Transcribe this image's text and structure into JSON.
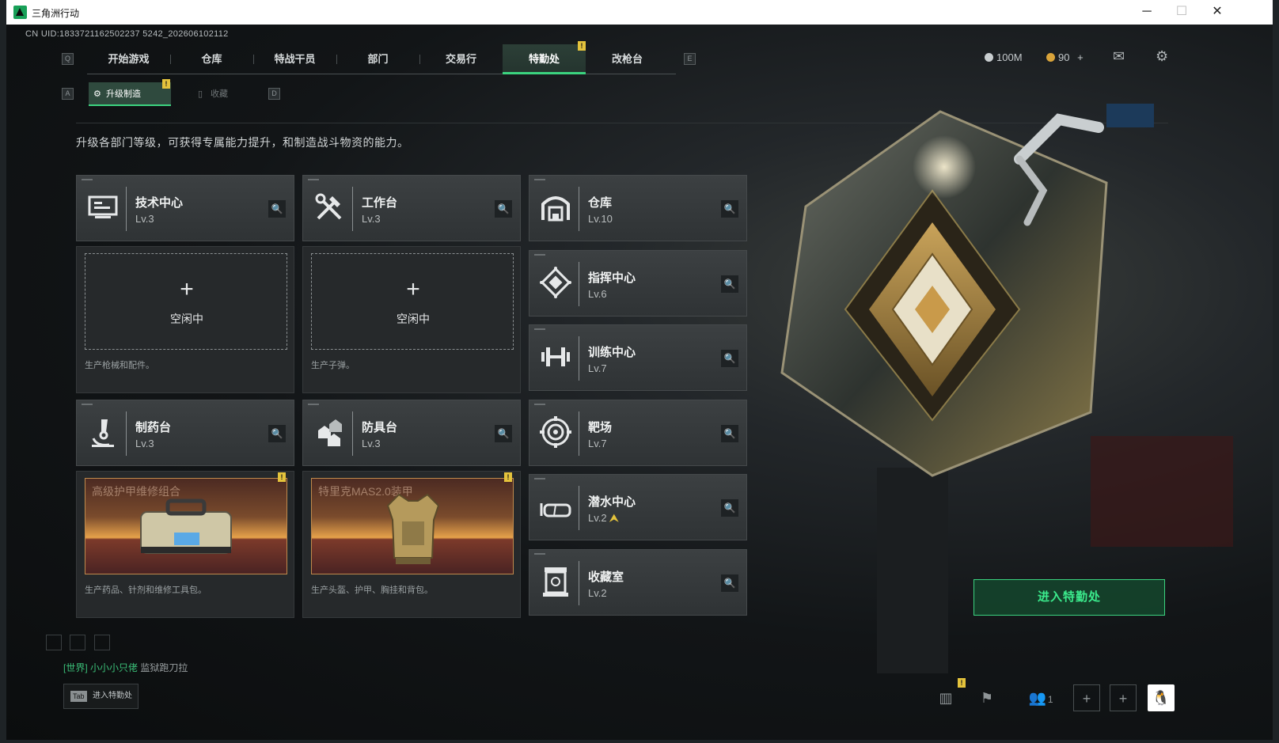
{
  "window": {
    "title": "三角洲行动",
    "minimize": "─",
    "maximize": "☐",
    "close": "✕"
  },
  "uid": "CN UID:1833721162502237 5242_202606102112",
  "nav": {
    "left_key": "Q",
    "right_key": "E",
    "tabs": [
      {
        "label": "开始游戏"
      },
      {
        "label": "仓库"
      },
      {
        "label": "特战干员"
      },
      {
        "label": "部门"
      },
      {
        "label": "交易行"
      },
      {
        "label": "特勤处",
        "active": true
      },
      {
        "label": "改枪台"
      }
    ],
    "badge": "!"
  },
  "currency": {
    "silver": "100M",
    "gold": "90",
    "gold_plus": "+"
  },
  "subnav": {
    "left_key": "A",
    "right_key": "D",
    "tabs": [
      {
        "label": "升级制造",
        "active": true
      },
      {
        "label": "收藏"
      }
    ],
    "badge": "!"
  },
  "description": "升级各部门等级，可获得专属能力提升，和制造战斗物资的能力。",
  "departments": [
    {
      "name": "技术中心",
      "level": "Lv.3",
      "icon": "computer-icon"
    },
    {
      "name": "工作台",
      "level": "Lv.3",
      "icon": "tools-icon"
    },
    {
      "name": "仓库",
      "level": "Lv.10",
      "icon": "warehouse-icon"
    },
    {
      "name": "指挥中心",
      "level": "Lv.6",
      "icon": "command-icon"
    },
    {
      "name": "训练中心",
      "level": "Lv.7",
      "icon": "dumbbell-icon"
    },
    {
      "name": "制药台",
      "level": "Lv.3",
      "icon": "microscope-icon"
    },
    {
      "name": "防具台",
      "level": "Lv.3",
      "icon": "armor-icon"
    },
    {
      "name": "靶场",
      "level": "Lv.7",
      "icon": "target-icon"
    },
    {
      "name": "潜水中心",
      "level": "Lv.2",
      "icon": "diving-mask-icon",
      "upgrade": "⮝"
    },
    {
      "name": "收藏室",
      "level": "Lv.2",
      "icon": "collection-icon"
    }
  ],
  "production": [
    {
      "plus": "+",
      "status": "空闲中",
      "desc": "生产枪械和配件。"
    },
    {
      "plus": "+",
      "status": "空闲中",
      "desc": "生产子弹。"
    },
    {
      "item": "高级护甲维修组合",
      "desc": "生产药品、针剂和维修工具包。",
      "badge": "!"
    },
    {
      "item": "特里克MAS2.0装甲",
      "desc": "生产头盔、护甲、胸挂和背包。",
      "badge": "!"
    }
  ],
  "enter_button": "进入特勤处",
  "chat": {
    "channel": "[世界]",
    "user": "小小小只佬",
    "message": "监狱跑刀拉"
  },
  "tab_button": {
    "key": "Tab",
    "label": "进入特勤处"
  },
  "bottom": {
    "friends_count": "1"
  },
  "colors": {
    "accent": "#3bd37f",
    "badge": "#e4c33c"
  }
}
